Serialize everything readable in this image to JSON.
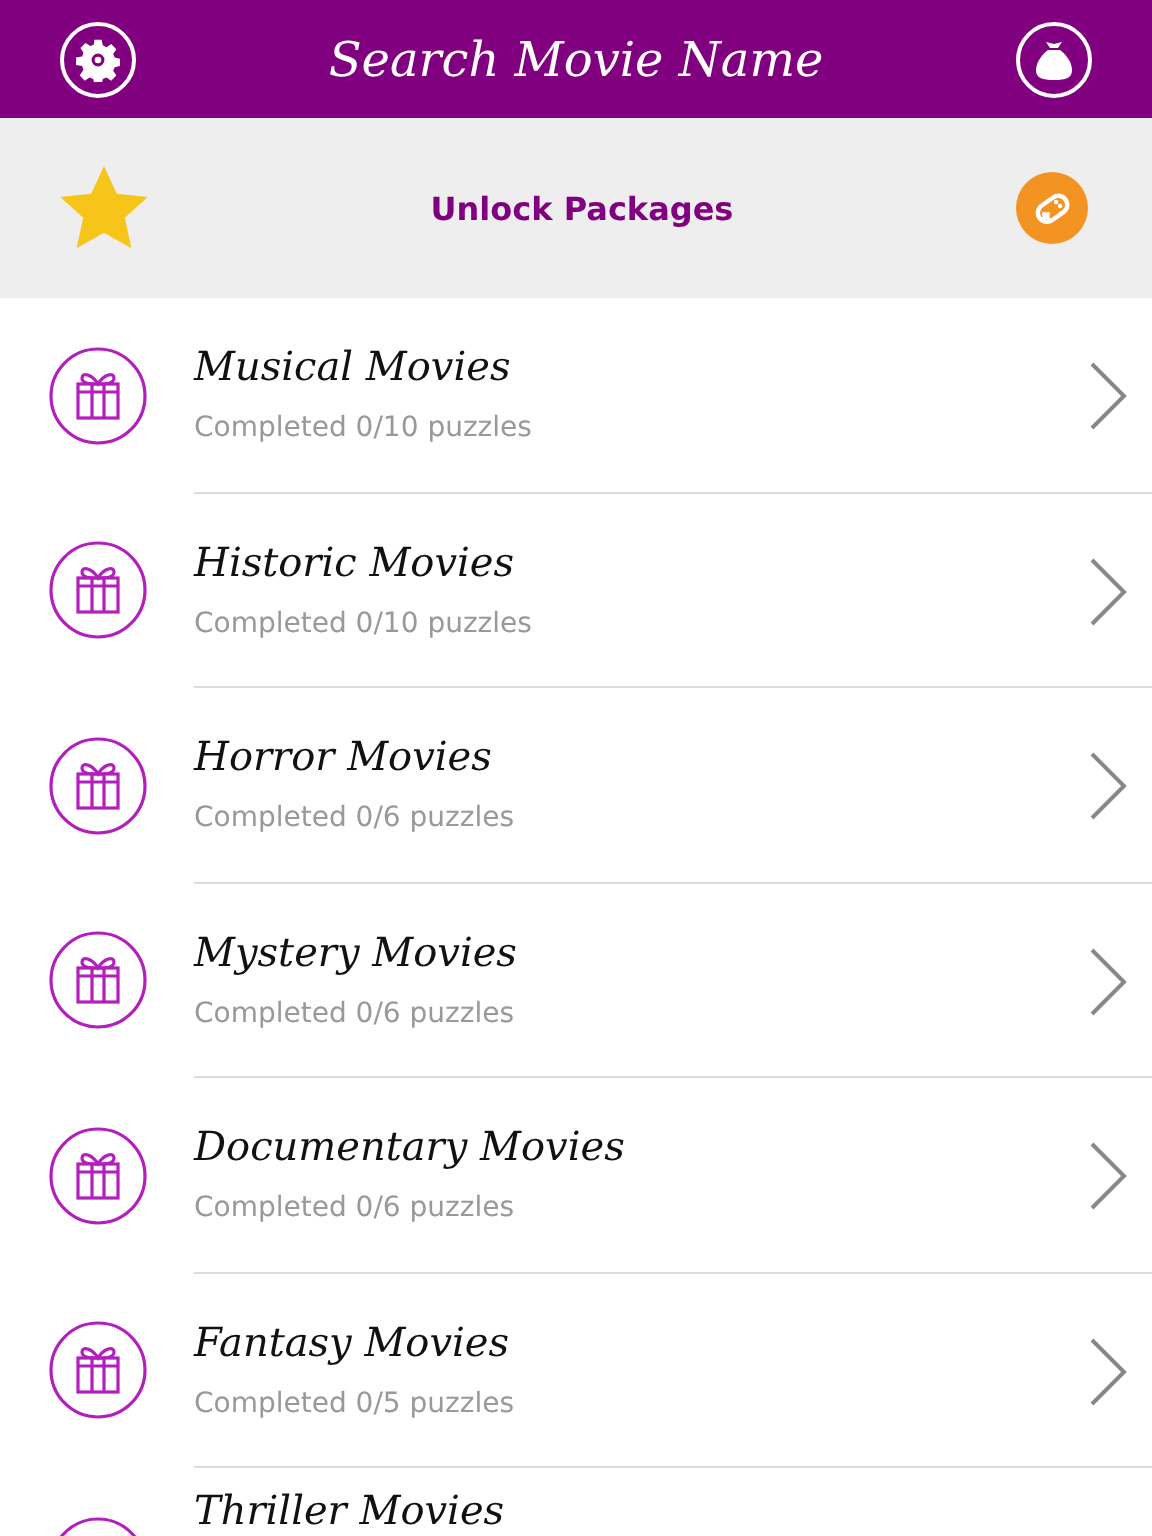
{
  "header": {
    "title": "Search Movie Name"
  },
  "banner": {
    "title": "Unlock Packages"
  },
  "packages": [
    {
      "title": "Musical Movies",
      "progress": "Completed 0/10 puzzles"
    },
    {
      "title": "Historic Movies",
      "progress": "Completed 0/10 puzzles"
    },
    {
      "title": "Horror Movies",
      "progress": "Completed 0/6 puzzles"
    },
    {
      "title": "Mystery Movies",
      "progress": "Completed 0/6 puzzles"
    },
    {
      "title": "Documentary Movies",
      "progress": "Completed 0/6 puzzles"
    },
    {
      "title": "Fantasy Movies",
      "progress": "Completed 0/5 puzzles"
    },
    {
      "title": "Thriller Movies"
    }
  ]
}
